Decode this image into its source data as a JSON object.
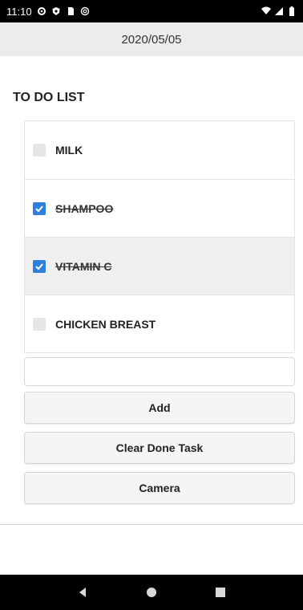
{
  "status_bar": {
    "time": "11:10",
    "left_icons": [
      "settings-icon",
      "shield-icon",
      "sim-card-icon",
      "at-sign-icon"
    ],
    "right_icons": [
      "wifi-icon",
      "signal-icon",
      "battery-icon"
    ]
  },
  "header": {
    "date": "2020/05/05"
  },
  "list": {
    "title": "TO DO LIST",
    "items": [
      {
        "label": "MILK",
        "done": false
      },
      {
        "label": "SHAMPOO",
        "done": true
      },
      {
        "label": "VITAMIN C",
        "done": true
      },
      {
        "label": "CHICKEN BREAST",
        "done": false
      }
    ]
  },
  "input": {
    "value": "",
    "placeholder": ""
  },
  "buttons": {
    "add": "Add",
    "clear_done": "Clear Done Task",
    "camera": "Camera"
  },
  "colors": {
    "checked": "#2f7fdc",
    "header_bg": "#ececec"
  },
  "nav": {
    "icons": [
      "back-icon",
      "home-icon",
      "recents-icon"
    ]
  }
}
